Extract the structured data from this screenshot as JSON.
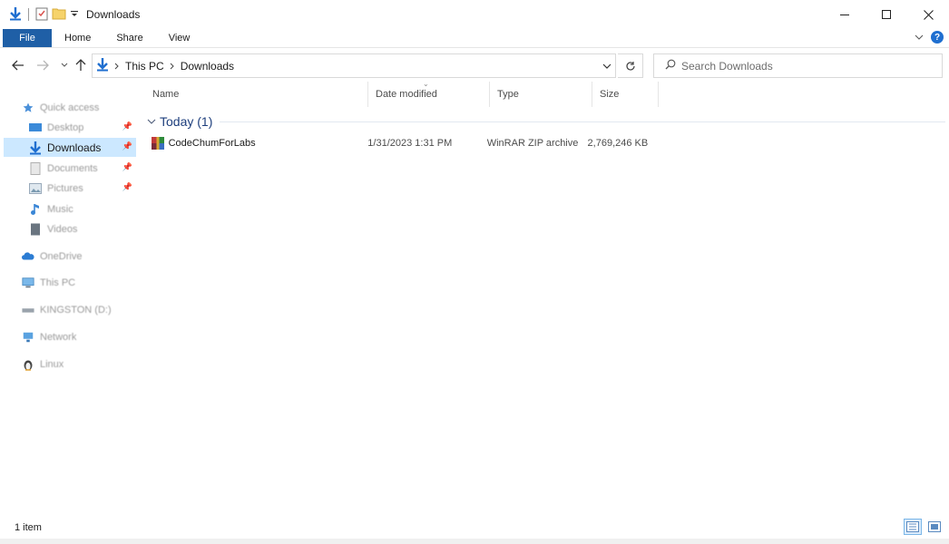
{
  "window": {
    "title": "Downloads"
  },
  "ribbon": {
    "tabs": [
      {
        "label": "File",
        "active": true
      },
      {
        "label": "Home"
      },
      {
        "label": "Share"
      },
      {
        "label": "View"
      }
    ]
  },
  "address": {
    "crumbs": [
      "This PC",
      "Downloads"
    ]
  },
  "search": {
    "placeholder": "Search Downloads"
  },
  "navpane": {
    "items": [
      {
        "label": "Quick access",
        "icon": "star-icon"
      },
      {
        "label": "Desktop",
        "icon": "desktop-icon",
        "pinned": true
      },
      {
        "label": "Downloads",
        "icon": "download-arrow-icon",
        "pinned": true,
        "selected": true
      },
      {
        "label": "Documents",
        "icon": "document-icon",
        "pinned": true
      },
      {
        "label": "Pictures",
        "icon": "pictures-icon",
        "pinned": true
      },
      {
        "label": "Music",
        "icon": "music-note-icon"
      },
      {
        "label": "Videos",
        "icon": "video-icon"
      },
      {
        "label": "OneDrive",
        "icon": "cloud-icon"
      },
      {
        "label": "This PC",
        "icon": "computer-icon"
      },
      {
        "label": "KINGSTON (D:)",
        "icon": "drive-icon"
      },
      {
        "label": "Network",
        "icon": "network-icon"
      },
      {
        "label": "Linux",
        "icon": "penguin-icon"
      }
    ]
  },
  "columns": {
    "name": "Name",
    "date": "Date modified",
    "type": "Type",
    "size": "Size"
  },
  "group": {
    "label": "Today (1)"
  },
  "files": [
    {
      "name": "CodeChumForLabs",
      "date": "1/31/2023 1:31 PM",
      "type": "WinRAR ZIP archive",
      "size": "2,769,246 KB",
      "icon": "winrar-archive-icon"
    }
  ],
  "status": {
    "count": "1 item"
  },
  "colors": {
    "accent": "#1f5fa6",
    "selection": "#cce8ff",
    "group_text": "#1e3f7d"
  }
}
